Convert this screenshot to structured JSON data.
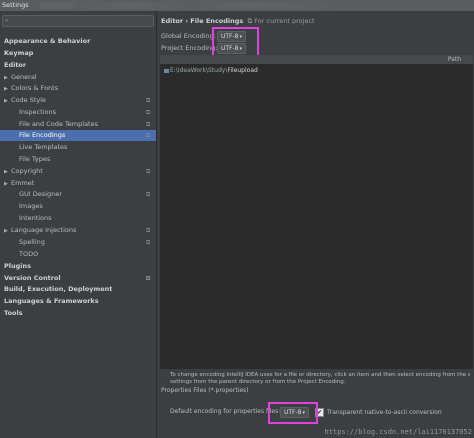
{
  "window": {
    "title": "Settings"
  },
  "sidebar": {
    "items": [
      {
        "label": "Appearance & Behavior",
        "bold": true,
        "arrow": false,
        "cfg": false,
        "selected": false,
        "indent": 0
      },
      {
        "label": "Keymap",
        "bold": true,
        "arrow": false,
        "cfg": false,
        "selected": false,
        "indent": 0
      },
      {
        "label": "Editor",
        "bold": true,
        "arrow": false,
        "cfg": false,
        "selected": false,
        "indent": 0
      },
      {
        "label": "General",
        "bold": false,
        "arrow": true,
        "cfg": false,
        "selected": false,
        "indent": 1
      },
      {
        "label": "Colors & Fonts",
        "bold": false,
        "arrow": true,
        "cfg": false,
        "selected": false,
        "indent": 1
      },
      {
        "label": "Code Style",
        "bold": false,
        "arrow": true,
        "cfg": true,
        "selected": false,
        "indent": 1
      },
      {
        "label": "Inspections",
        "bold": false,
        "arrow": false,
        "cfg": true,
        "selected": false,
        "indent": 2
      },
      {
        "label": "File and Code Templates",
        "bold": false,
        "arrow": false,
        "cfg": true,
        "selected": false,
        "indent": 2
      },
      {
        "label": "File Encodings",
        "bold": false,
        "arrow": false,
        "cfg": true,
        "selected": true,
        "indent": 2
      },
      {
        "label": "Live Templates",
        "bold": false,
        "arrow": false,
        "cfg": false,
        "selected": false,
        "indent": 2
      },
      {
        "label": "File Types",
        "bold": false,
        "arrow": false,
        "cfg": false,
        "selected": false,
        "indent": 2
      },
      {
        "label": "Copyright",
        "bold": false,
        "arrow": true,
        "cfg": true,
        "selected": false,
        "indent": 1
      },
      {
        "label": "Emmet",
        "bold": false,
        "arrow": true,
        "cfg": false,
        "selected": false,
        "indent": 1
      },
      {
        "label": "GUI Designer",
        "bold": false,
        "arrow": false,
        "cfg": true,
        "selected": false,
        "indent": 2
      },
      {
        "label": "Images",
        "bold": false,
        "arrow": false,
        "cfg": false,
        "selected": false,
        "indent": 2
      },
      {
        "label": "Intentions",
        "bold": false,
        "arrow": false,
        "cfg": false,
        "selected": false,
        "indent": 2
      },
      {
        "label": "Language Injections",
        "bold": false,
        "arrow": true,
        "cfg": true,
        "selected": false,
        "indent": 1
      },
      {
        "label": "Spelling",
        "bold": false,
        "arrow": false,
        "cfg": true,
        "selected": false,
        "indent": 2
      },
      {
        "label": "TODO",
        "bold": false,
        "arrow": false,
        "cfg": false,
        "selected": false,
        "indent": 2
      },
      {
        "label": "Plugins",
        "bold": true,
        "arrow": false,
        "cfg": false,
        "selected": false,
        "indent": 0
      },
      {
        "label": "Version Control",
        "bold": true,
        "arrow": false,
        "cfg": true,
        "selected": false,
        "indent": 0
      },
      {
        "label": "Build, Execution, Deployment",
        "bold": true,
        "arrow": false,
        "cfg": false,
        "selected": false,
        "indent": 0
      },
      {
        "label": "Languages & Frameworks",
        "bold": true,
        "arrow": false,
        "cfg": false,
        "selected": false,
        "indent": 0
      },
      {
        "label": "Tools",
        "bold": true,
        "arrow": false,
        "cfg": false,
        "selected": false,
        "indent": 0
      }
    ]
  },
  "main": {
    "breadcrumb": "Editor › File Encodings",
    "breadcrumb_sub": "For current project",
    "global_label": "Global Encoding:",
    "global_value": "UTF-8",
    "project_label": "Project Encoding:",
    "project_value": "UTF-8",
    "table_path_header": "Path",
    "folder_prefix": "E:\\IdeaWork\\Study\\",
    "folder_last": "Fileupload",
    "description_1": "To change encoding IntelliJ IDEA uses for a file or directory, click an item and then select encoding from the encoding list.",
    "description_2": "settings from the parent directory or from the Project Encoding.",
    "props_title": "Properties Files (*.properties)",
    "props_default_label": "Default encoding for properties files:",
    "props_default_value": "UTF-8",
    "props_checkbox_label": "Transparent native-to-ascii conversion",
    "props_checkbox_checked": true
  },
  "watermark": "https://blog.csdn.net/lai1170137052",
  "colors": {
    "highlight": "#e040e0",
    "selection": "#4b6eaf",
    "background": "#3c3f41"
  }
}
